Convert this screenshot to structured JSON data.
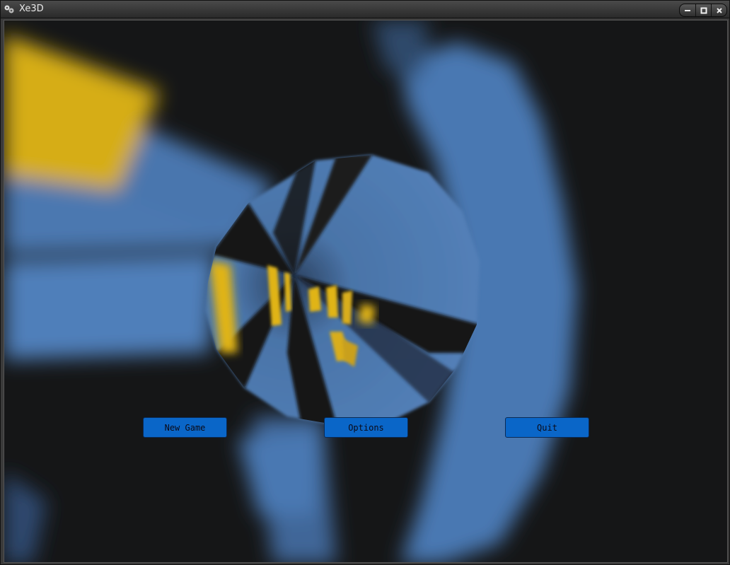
{
  "window": {
    "title": "Xe3D",
    "controls": [
      "minimize-icon",
      "maximize-icon",
      "close-icon"
    ]
  },
  "scene": {
    "description_colors": {
      "background": "#151617",
      "tunnel_blue": "#4f7cb4",
      "tunnel_yellow": "#e0b418"
    }
  },
  "menu": {
    "new_game_label": "New Game",
    "options_label": "Options",
    "quit_label": "Quit",
    "button_color": "#0a66c8"
  }
}
